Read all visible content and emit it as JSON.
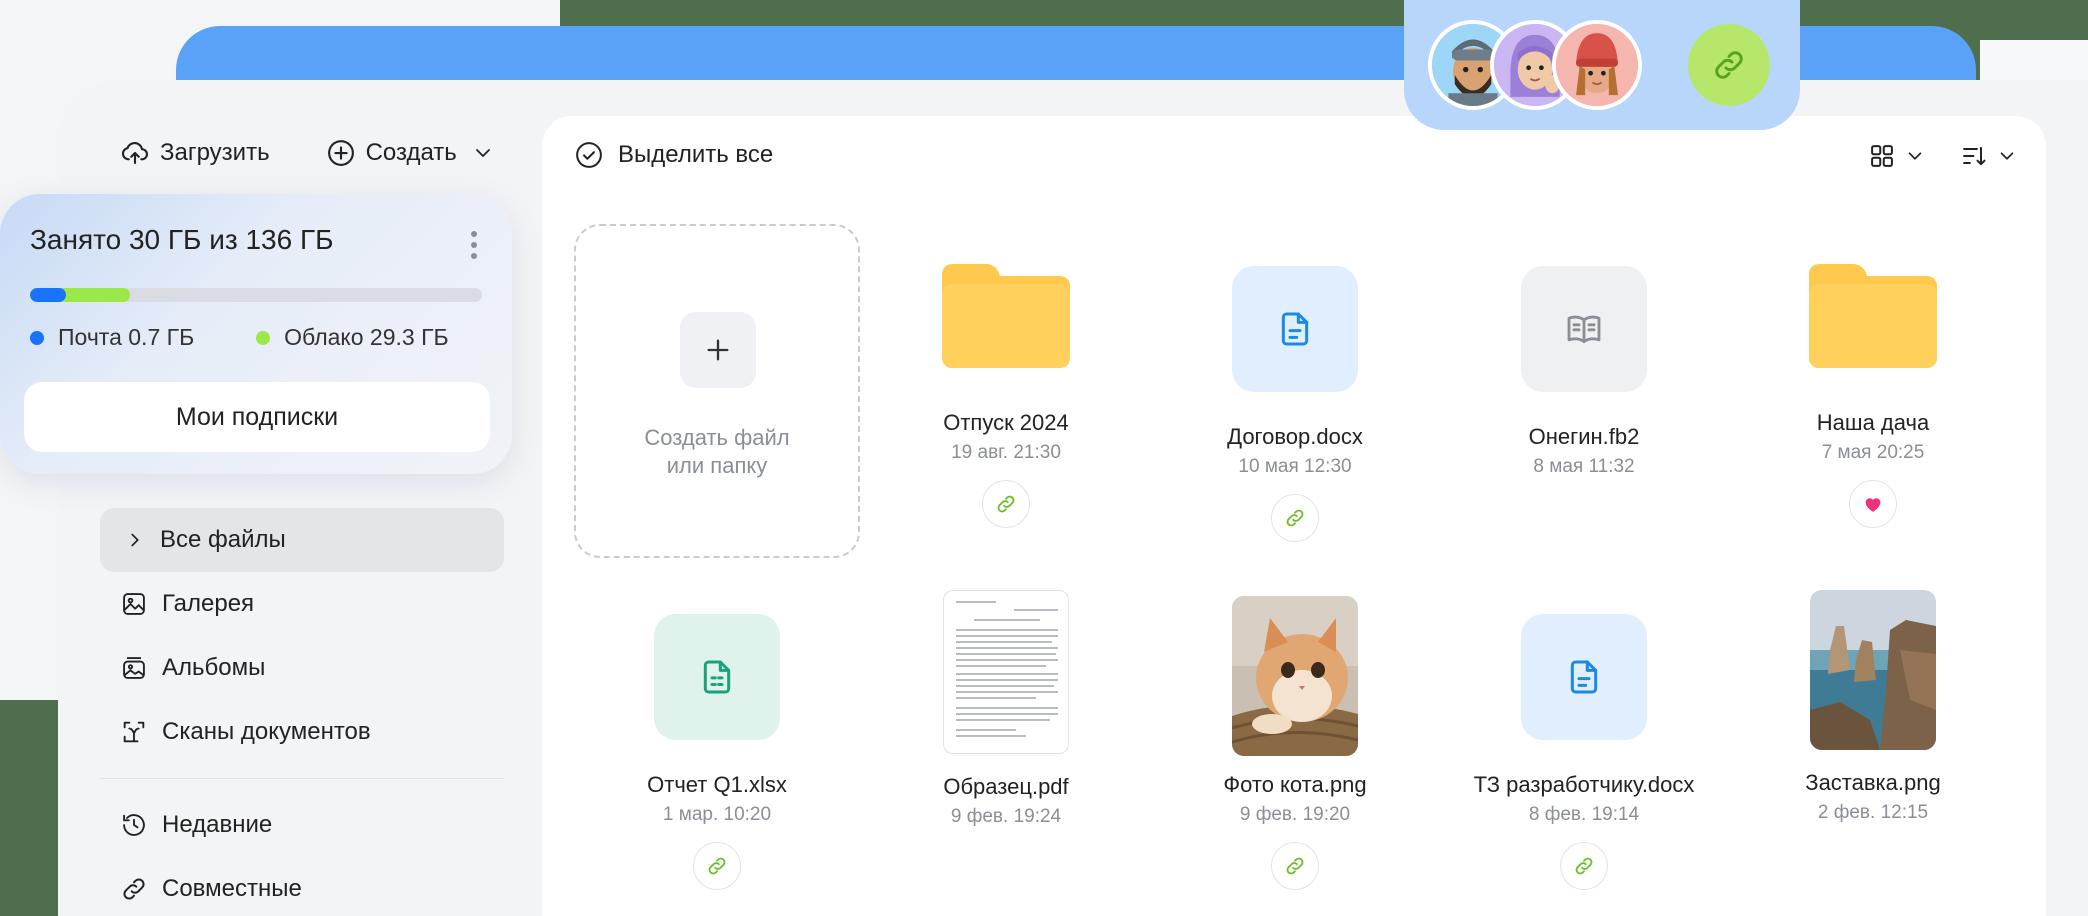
{
  "toolbar": {
    "upload_label": "Загрузить",
    "create_label": "Создать"
  },
  "storage": {
    "title": "Занято 30 ГБ из 136 ГБ",
    "used_gb": 30,
    "total_gb": 136,
    "mail_label": "Почта 0.7 ГБ",
    "mail_gb": 0.7,
    "cloud_label": "Облако 29.3 ГБ",
    "cloud_gb": 29.3,
    "subscriptions_label": "Мои подписки",
    "colors": {
      "mail": "#1a73ff",
      "cloud": "#9be84b"
    }
  },
  "nav": {
    "all_files": "Все файлы",
    "gallery": "Галерея",
    "albums": "Альбомы",
    "scans": "Сканы документов",
    "recent": "Недавние",
    "shared": "Совместные"
  },
  "main": {
    "select_all": "Выделить все",
    "create_tile_line1": "Создать файл",
    "create_tile_line2": "или папку"
  },
  "files": [
    {
      "name": "Отпуск 2024",
      "date": "19 авг. 21:30",
      "type": "folder",
      "badge": "link"
    },
    {
      "name": "Договор.docx",
      "date": "10 мая 12:30",
      "type": "doc",
      "badge": "link"
    },
    {
      "name": "Онегин.fb2",
      "date": "8 мая 11:32",
      "type": "book",
      "badge": "none"
    },
    {
      "name": "Наша дача",
      "date": "7 мая 20:25",
      "type": "folder",
      "badge": "heart"
    },
    {
      "name": "Отчет Q1.xlsx",
      "date": "1 мар. 10:20",
      "type": "sheet",
      "badge": "link"
    },
    {
      "name": "Образец.pdf",
      "date": "9 фев. 19:24",
      "type": "pdf",
      "badge": "none"
    },
    {
      "name": "Фото кота.png",
      "date": "9 фев. 19:20",
      "type": "photo-cat",
      "badge": "link"
    },
    {
      "name": "ТЗ разработчику.docx",
      "date": "8 фев. 19:14",
      "type": "doc",
      "badge": "link"
    },
    {
      "name": "Заставка.png",
      "date": "2 фев. 12:15",
      "type": "photo-sea",
      "badge": "none"
    }
  ],
  "colors": {
    "accent_blue": "#5aa2f8",
    "link_green": "#b6e76a",
    "folder_yellow": "#ffc94d",
    "heart_pink": "#f0307a"
  }
}
